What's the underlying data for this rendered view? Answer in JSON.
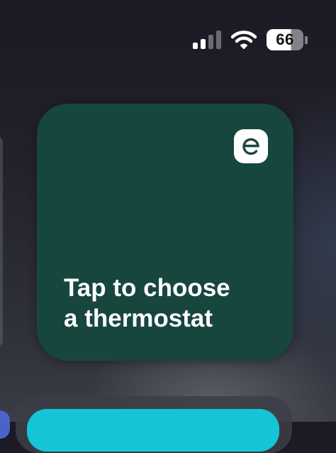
{
  "status_bar": {
    "signal_bars_active": 2,
    "signal_bars_total": 4,
    "battery_percent": "66"
  },
  "widget": {
    "background_color": "#17463f",
    "app_icon": "ecobee-e-icon",
    "message_line1": "Tap to choose",
    "message_line2": "a thermostat"
  },
  "dock": {
    "tile_color": "#16c4d8",
    "partial_icon_color": "#4b63c9"
  }
}
